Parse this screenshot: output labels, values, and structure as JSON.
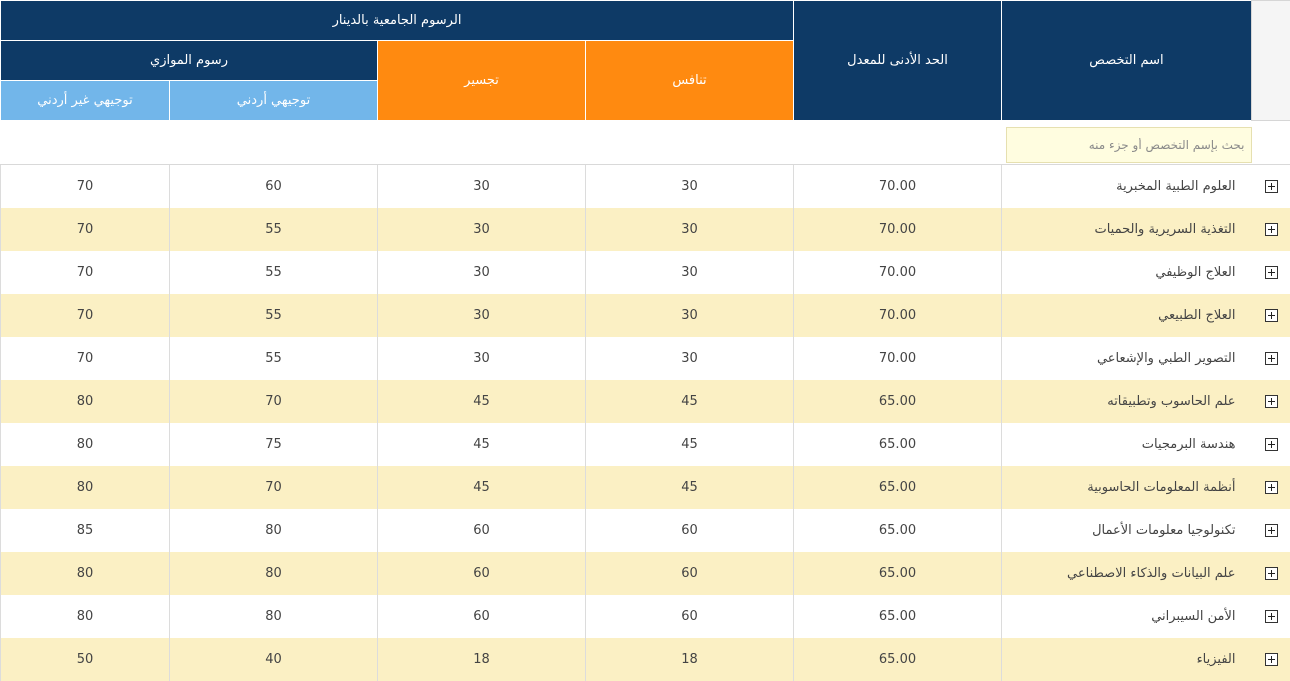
{
  "table": {
    "headers": {
      "major_name": "اسم التخصص",
      "min_average": "الحد الأدنى للمعدل",
      "university_fees": "الرسوم الجامعية بالدينار",
      "competition": "تنافس",
      "bridging": "تجسير",
      "parallel_fees": "رسوم الموازي",
      "jordanian": "توجيهي أردني",
      "non_jordanian": "توجيهي غير أردني"
    },
    "search": {
      "placeholder": "بحث بإسم التخصص أو جزء منه",
      "value": ""
    },
    "rows": [
      {
        "name": "العلوم الطبية المخبرية",
        "min": "70.00",
        "comp": "30",
        "bridge": "30",
        "jo": "60",
        "nonjo": "70"
      },
      {
        "name": "التغذية السريرية والحميات",
        "min": "70.00",
        "comp": "30",
        "bridge": "30",
        "jo": "55",
        "nonjo": "70"
      },
      {
        "name": "العلاج الوظيفي",
        "min": "70.00",
        "comp": "30",
        "bridge": "30",
        "jo": "55",
        "nonjo": "70"
      },
      {
        "name": "العلاج الطبيعي",
        "min": "70.00",
        "comp": "30",
        "bridge": "30",
        "jo": "55",
        "nonjo": "70"
      },
      {
        "name": "التصوير الطبي والإشعاعي",
        "min": "70.00",
        "comp": "30",
        "bridge": "30",
        "jo": "55",
        "nonjo": "70"
      },
      {
        "name": "علم الحاسوب وتطبيقاته",
        "min": "65.00",
        "comp": "45",
        "bridge": "45",
        "jo": "70",
        "nonjo": "80"
      },
      {
        "name": "هندسة البرمجيات",
        "min": "65.00",
        "comp": "45",
        "bridge": "45",
        "jo": "75",
        "nonjo": "80"
      },
      {
        "name": "أنظمة المعلومات الحاسوبية",
        "min": "65.00",
        "comp": "45",
        "bridge": "45",
        "jo": "70",
        "nonjo": "80"
      },
      {
        "name": "تكنولوجيا معلومات الأعمال",
        "min": "65.00",
        "comp": "60",
        "bridge": "60",
        "jo": "80",
        "nonjo": "85"
      },
      {
        "name": "علم البيانات والذكاء الاصطناعي",
        "min": "65.00",
        "comp": "60",
        "bridge": "60",
        "jo": "80",
        "nonjo": "80"
      },
      {
        "name": "الأمن السيبراني",
        "min": "65.00",
        "comp": "60",
        "bridge": "60",
        "jo": "80",
        "nonjo": "80"
      },
      {
        "name": "الفيزياء",
        "min": "65.00",
        "comp": "18",
        "bridge": "18",
        "jo": "40",
        "nonjo": "50"
      }
    ]
  },
  "icons": {
    "expand": "plus-square-icon"
  },
  "colors": {
    "header_navy": "#0e3a66",
    "header_orange": "#ff8a10",
    "header_light_blue": "#72b6ea",
    "row_stripe": "#fbf0c4",
    "search_bg": "#fffde0"
  }
}
